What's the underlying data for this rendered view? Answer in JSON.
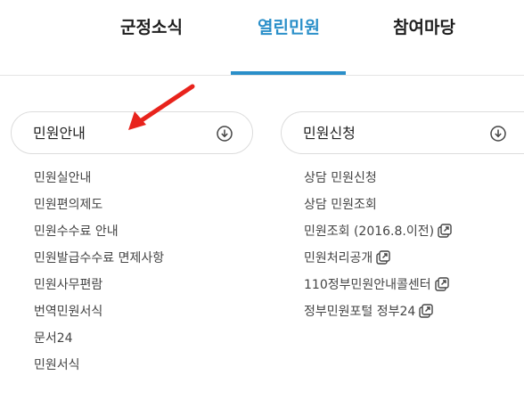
{
  "tabs": [
    {
      "label": "군정소식"
    },
    {
      "label": "열린민원"
    },
    {
      "label": "참여마당"
    }
  ],
  "active_tab_color": "#2a8fc9",
  "annotation_color": "#e8231c",
  "left": {
    "title": "민원안내",
    "links": [
      {
        "label": "민원실안내"
      },
      {
        "label": "민원편의제도"
      },
      {
        "label": "민원수수료 안내"
      },
      {
        "label": "민원발급수수료 면제사항"
      },
      {
        "label": "민원사무편람"
      },
      {
        "label": "번역민원서식"
      },
      {
        "label": "문서24"
      },
      {
        "label": "민원서식"
      }
    ]
  },
  "right": {
    "title": "민원신청",
    "links": [
      {
        "label": "상담 민원신청",
        "external": false
      },
      {
        "label": "상담 민원조회",
        "external": false
      },
      {
        "label": "민원조회 (2016.8.이전)",
        "external": true
      },
      {
        "label": "민원처리공개",
        "external": true
      },
      {
        "label": "110정부민원안내콜센터",
        "external": true
      },
      {
        "label": "정부민원포털 정부24",
        "external": true
      }
    ]
  },
  "icons": {
    "toggle": "download-circle-icon",
    "external": "external-link-icon"
  }
}
